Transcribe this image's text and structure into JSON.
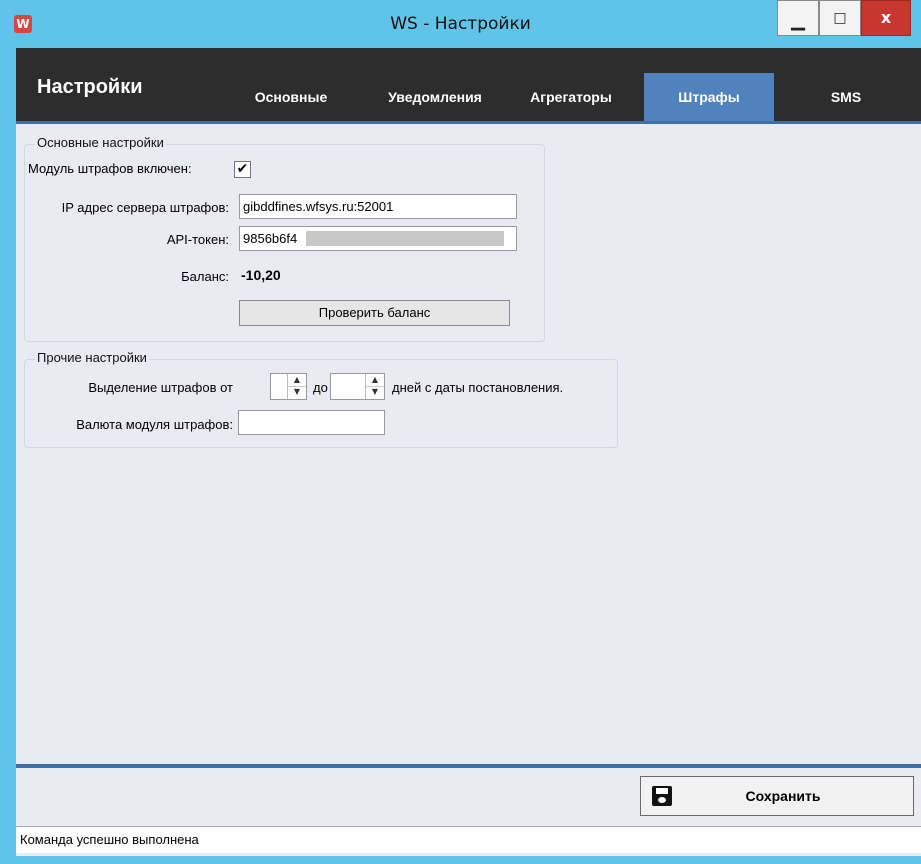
{
  "window": {
    "title": "WS - Настройки",
    "icon_letter": "W",
    "minimize_glyph": "▁",
    "maximize_glyph": "□",
    "close_glyph": "x"
  },
  "header": {
    "title": "Настройки",
    "tabs": [
      {
        "label": "Основные",
        "active": false
      },
      {
        "label": "Уведомления",
        "active": false
      },
      {
        "label": "Агрегаторы",
        "active": false
      },
      {
        "label": "Штрафы",
        "active": true
      },
      {
        "label": "SMS",
        "active": false
      }
    ]
  },
  "basic_settings": {
    "title": "Основные настройки",
    "module_enabled_label": "Модуль штрафов включен:",
    "module_enabled": true,
    "check_glyph": "✔",
    "server_ip_label": "IP адрес сервера штрафов:",
    "server_ip_value": "gibddfines.wfsys.ru:52001",
    "api_token_label": "API-токен:",
    "api_token_value": "9856b6f4",
    "balance_label": "Баланс:",
    "balance_value": "-10,20",
    "check_balance_button": "Проверить баланс"
  },
  "other_settings": {
    "title": "Прочие настройки",
    "highlight_from_label": "Выделение штрафов от",
    "to_label": "до",
    "days_suffix": "дней с даты постановления.",
    "from_value": "",
    "to_value": "",
    "currency_label": "Валюта модуля штрафов:",
    "currency_value": "",
    "spin_up_glyph": "▲",
    "spin_down_glyph": "▼"
  },
  "footer": {
    "save_button": "Сохранить",
    "status_text": "Команда успешно выполнена"
  },
  "colors": {
    "title_bar": "#5fc4e8",
    "header_bg": "#2d2d2d",
    "active_tab": "#5083bd",
    "accent_line": "#3d6fa8",
    "close_button": "#c7372f"
  }
}
